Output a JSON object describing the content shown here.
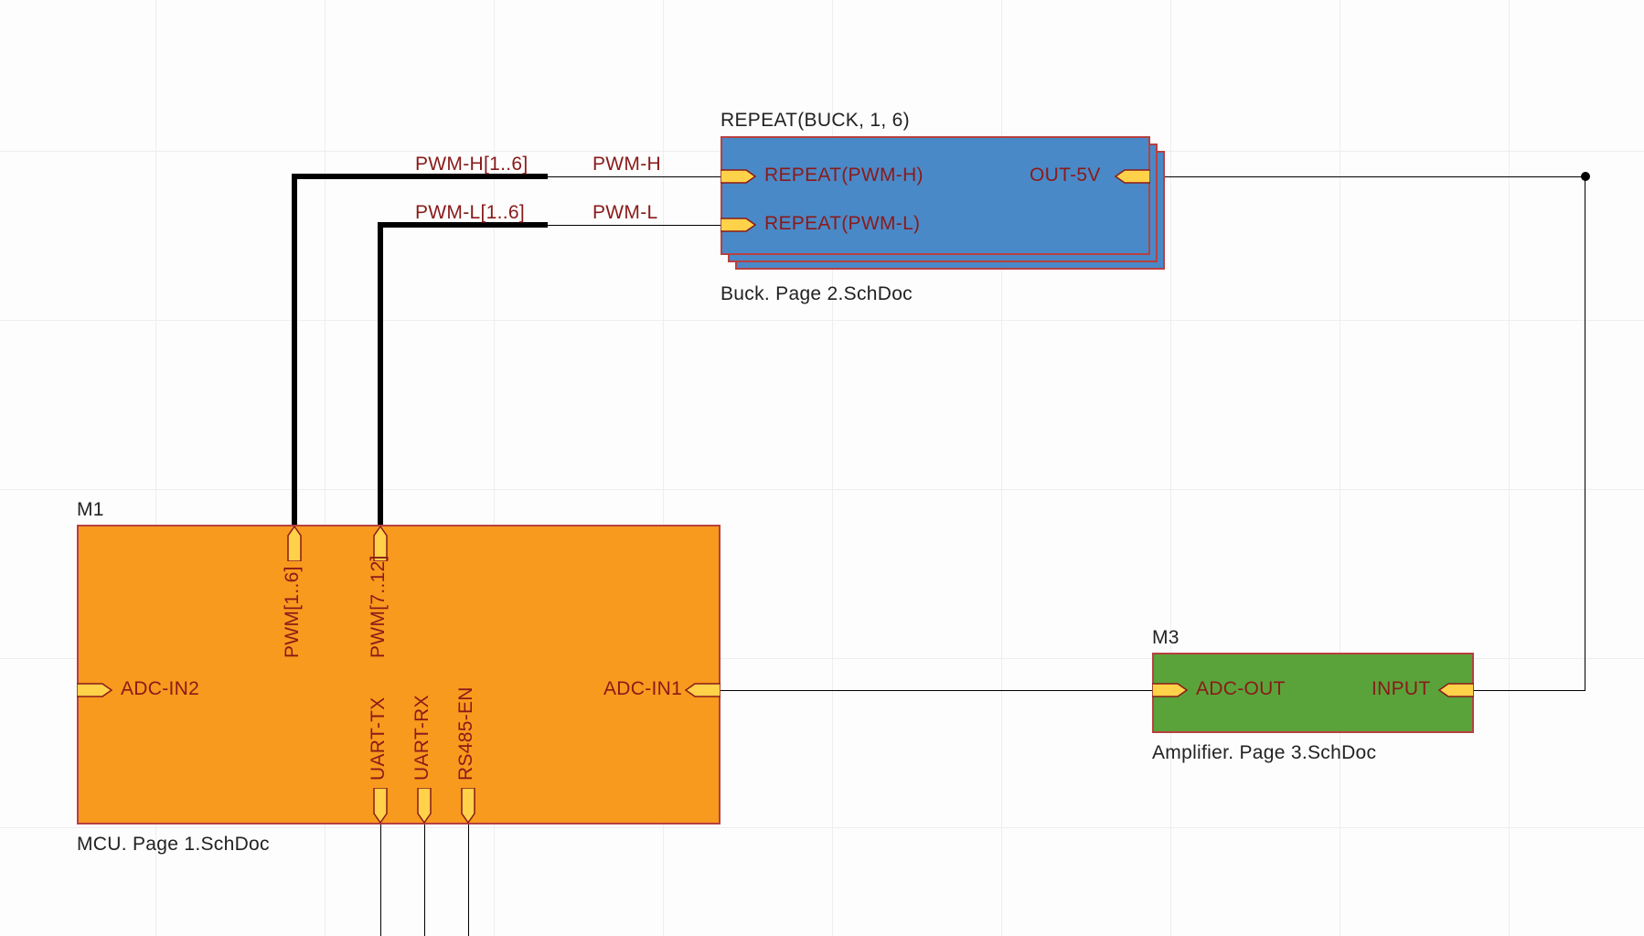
{
  "buck": {
    "title": "REPEAT(BUCK, 1, 6)",
    "caption": "Buck. Page 2.SchDoc",
    "ports": {
      "pwm_h": "REPEAT(PWM-H)",
      "pwm_l": "REPEAT(PWM-L)",
      "out": "OUT-5V"
    }
  },
  "mcu": {
    "designator": "M1",
    "caption": "MCU. Page 1.SchDoc",
    "ports": {
      "adc_in2": "ADC-IN2",
      "adc_in1": "ADC-IN1",
      "pwm_a": "PWM[1..6]",
      "pwm_b": "PWM[7..12]",
      "uart_tx": "UART-TX",
      "uart_rx": "UART-RX",
      "rs485_en": "RS485-EN"
    }
  },
  "amp": {
    "designator": "M3",
    "caption": "Amplifier. Page 3.SchDoc",
    "ports": {
      "adc_out": "ADC-OUT",
      "input": "INPUT"
    }
  },
  "nets": {
    "pwm_h_bus": "PWM-H[1..6]",
    "pwm_l_bus": "PWM-L[1..6]",
    "pwm_h": "PWM-H",
    "pwm_l": "PWM-L"
  }
}
